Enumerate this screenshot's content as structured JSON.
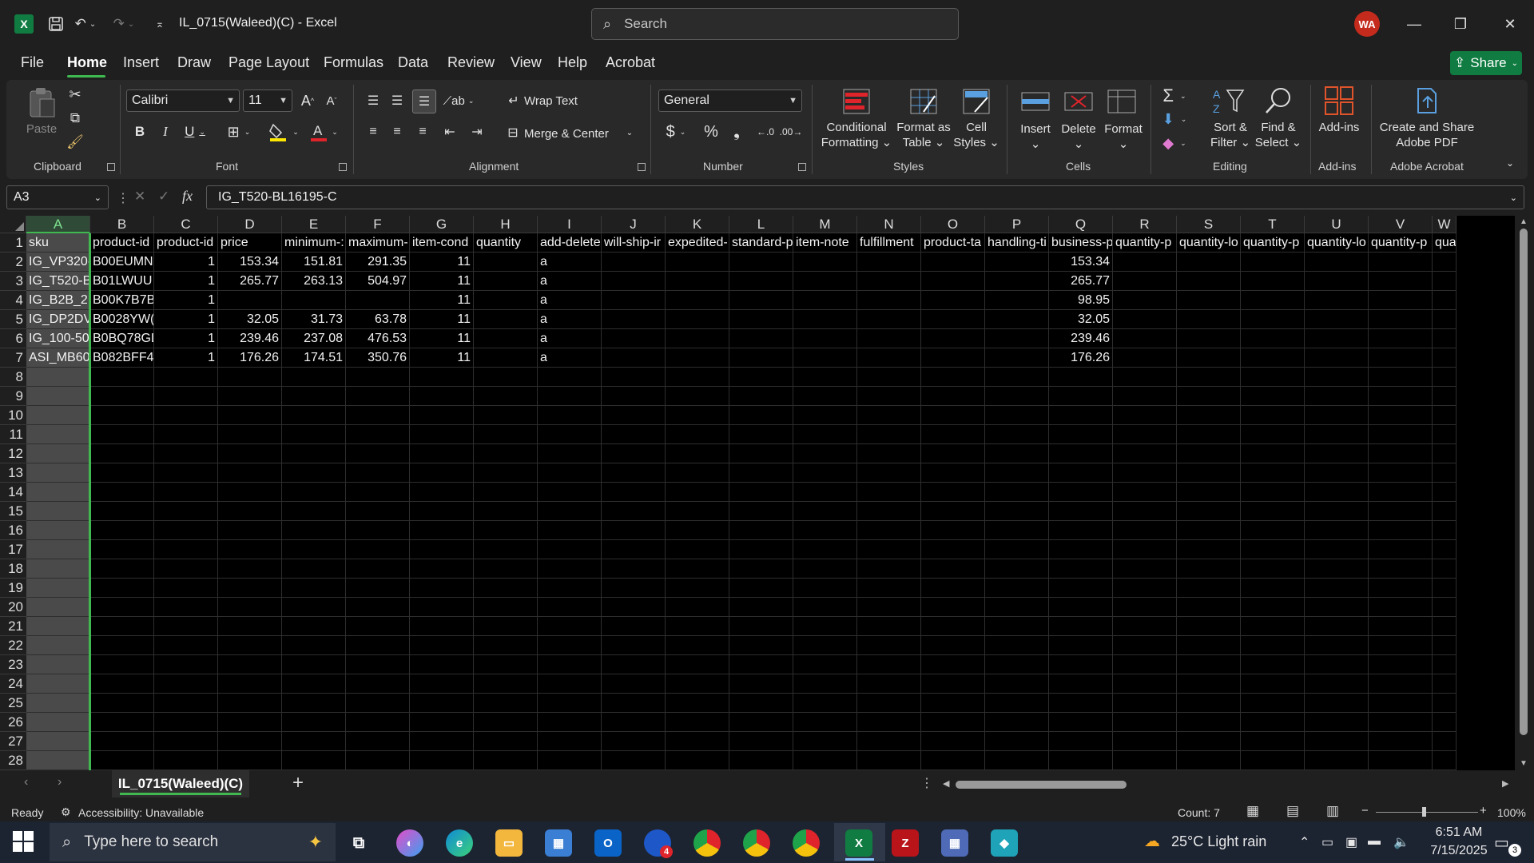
{
  "window": {
    "title": "IL_0715(Waleed)(C)  -  Excel",
    "search_placeholder": "Search",
    "user_initials": "WA"
  },
  "menu": {
    "items": [
      "File",
      "Home",
      "Insert",
      "Draw",
      "Page Layout",
      "Formulas",
      "Data",
      "Review",
      "View",
      "Help",
      "Acrobat"
    ],
    "active": "Home",
    "share_label": "Share"
  },
  "ribbon": {
    "clipboard": {
      "paste_label": "Paste",
      "group_label": "Clipboard"
    },
    "font": {
      "font_name": "Calibri",
      "font_size": "11",
      "group_label": "Font"
    },
    "alignment": {
      "wrap_text": "Wrap Text",
      "merge_center": "Merge & Center",
      "group_label": "Alignment"
    },
    "number": {
      "format": "General",
      "group_label": "Number"
    },
    "styles": {
      "conditional_1": "Conditional",
      "conditional_2": "Formatting",
      "format_table_1": "Format as",
      "format_table_2": "Table",
      "cell_styles_1": "Cell",
      "cell_styles_2": "Styles",
      "group_label": "Styles"
    },
    "cells": {
      "insert": "Insert",
      "delete": "Delete",
      "format": "Format",
      "group_label": "Cells"
    },
    "editing": {
      "sort_1": "Sort &",
      "sort_2": "Filter",
      "find_1": "Find &",
      "find_2": "Select",
      "group_label": "Editing"
    },
    "addins": {
      "label": "Add-ins",
      "group_label": "Add-ins"
    },
    "acrobat": {
      "label_1": "Create and Share",
      "label_2": "Adobe PDF",
      "group_label": "Adobe Acrobat"
    }
  },
  "formula_bar": {
    "name_box": "A3",
    "formula": "IG_T520-BL16195-C"
  },
  "grid": {
    "columns": [
      "A",
      "B",
      "C",
      "D",
      "E",
      "F",
      "G",
      "H",
      "I",
      "J",
      "K",
      "L",
      "M",
      "N",
      "O",
      "P",
      "Q",
      "R",
      "S",
      "T",
      "U",
      "V",
      "W"
    ],
    "row_numbers": [
      "1",
      "2",
      "3",
      "4",
      "5",
      "6",
      "7",
      "8",
      "9",
      "10",
      "11",
      "12",
      "13",
      "14",
      "15",
      "16",
      "17",
      "18",
      "19",
      "20",
      "21",
      "22",
      "23",
      "24",
      "25",
      "26",
      "27",
      "28"
    ],
    "header_row": [
      "sku",
      "product-id",
      "product-id",
      "price",
      "minimum-:",
      "maximum-",
      "item-cond",
      "quantity",
      "add-delete",
      "will-ship-ir",
      "expedited-",
      "standard-p",
      "item-note",
      "fulfillment",
      "product-ta",
      "handling-ti",
      "business-p",
      "quantity-p",
      "quantity-lo",
      "quantity-p",
      "quantity-lo",
      "quantity-p",
      "quantity-lo"
    ],
    "data_rows": [
      {
        "A": "IG_VP320-",
        "B": "B00EUMN",
        "C": "1",
        "D": "153.34",
        "E": "151.81",
        "F": "291.35",
        "G": "11",
        "I": "a",
        "Q": "153.34"
      },
      {
        "A": "IG_T520-B",
        "B": "B01LWUU",
        "C": "1",
        "D": "265.77",
        "E": "263.13",
        "F": "504.97",
        "G": "11",
        "I": "a",
        "Q": "265.77"
      },
      {
        "A": "IG_B2B_2.",
        "B": "B00K7B7B",
        "C": "1",
        "D": "",
        "E": "",
        "F": "",
        "G": "11",
        "I": "a",
        "Q": "98.95"
      },
      {
        "A": "IG_DP2DV",
        "B": "B0028YW(",
        "C": "1",
        "D": "32.05",
        "E": "31.73",
        "F": "63.78",
        "G": "11",
        "I": "a",
        "Q": "32.05"
      },
      {
        "A": "IG_100-50",
        "B": "B0BQ78GL",
        "C": "1",
        "D": "239.46",
        "E": "237.08",
        "F": "476.53",
        "G": "11",
        "I": "a",
        "Q": "239.46"
      },
      {
        "A": "ASI_MB60",
        "B": "B082BFF4I",
        "C": "1",
        "D": "176.26",
        "E": "174.51",
        "F": "350.76",
        "G": "11",
        "I": "a",
        "Q": "176.26"
      }
    ]
  },
  "sheets": {
    "active_tab": "IL_0715(Waleed)(C)"
  },
  "status": {
    "ready": "Ready",
    "accessibility": "Accessibility: Unavailable",
    "count": "Count: 7",
    "zoom": "100%"
  },
  "taskbar": {
    "search_placeholder": "Type here to search",
    "weather": "25°C  Light rain",
    "time": "6:51 AM",
    "date": "7/15/2025",
    "notification_count": "3",
    "mail_badge": "4"
  }
}
